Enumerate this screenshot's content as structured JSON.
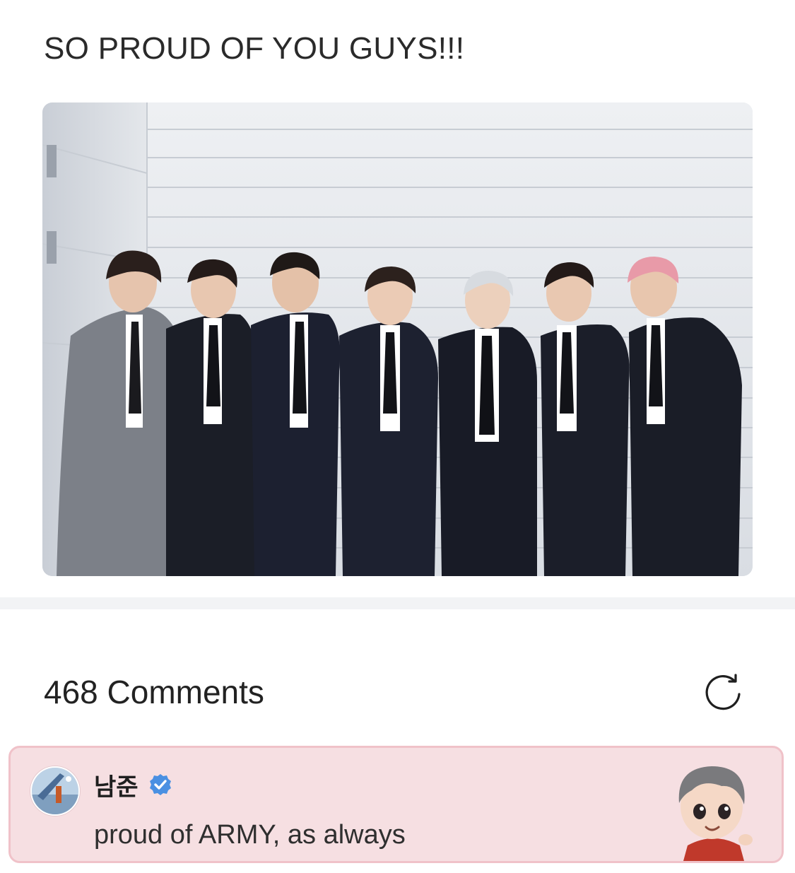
{
  "post": {
    "text": "SO PROUD OF YOU GUYS!!!",
    "photo": {
      "icon": "group-photo",
      "background_color": "#dfe3e8"
    }
  },
  "comments": {
    "count_label": "468 Comments",
    "refresh_icon": "refresh-icon",
    "items": [
      {
        "author": "남준",
        "verified": true,
        "verified_color": "#4a90e2",
        "text": "proud of ARMY, as always",
        "highlight_color": "#f6dfe2",
        "border_color": "#f0c2c9",
        "sticker_icon": "character-sticker"
      }
    ]
  }
}
